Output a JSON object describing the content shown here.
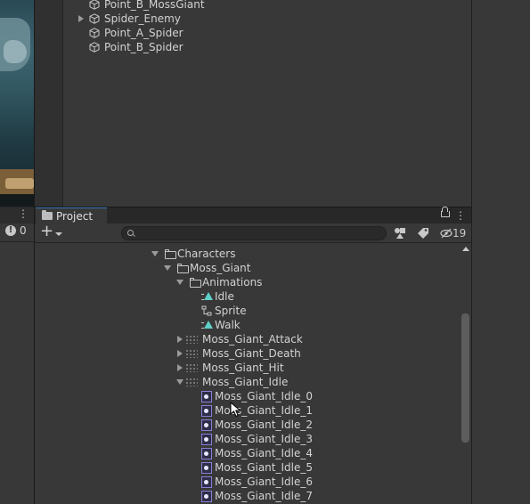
{
  "hierarchy": {
    "items": [
      {
        "label": "Point_B_MossGiant",
        "expandable": false
      },
      {
        "label": "Spider_Enemy",
        "expandable": true
      },
      {
        "label": "Point_A_Spider",
        "expandable": false
      },
      {
        "label": "Point_B_Spider",
        "expandable": false
      }
    ]
  },
  "console": {
    "info_count": "0"
  },
  "project": {
    "tab_label": "Project",
    "search_placeholder": "",
    "hidden_count": "19",
    "tree": [
      {
        "label": "Characters",
        "icon": "folder-open-icon",
        "depth": 0,
        "state": "expanded"
      },
      {
        "label": "Moss_Giant",
        "icon": "folder-open-icon",
        "depth": 1,
        "state": "expanded"
      },
      {
        "label": "Animations",
        "icon": "folder-open-icon",
        "depth": 2,
        "state": "expanded"
      },
      {
        "label": "Idle",
        "icon": "animation-clip-icon",
        "depth": 3,
        "state": "leaf"
      },
      {
        "label": "Sprite",
        "icon": "animator-controller-icon",
        "depth": 3,
        "state": "leaf"
      },
      {
        "label": "Walk",
        "icon": "animation-clip-icon",
        "depth": 3,
        "state": "leaf"
      },
      {
        "label": "Moss_Giant_Attack",
        "icon": "sprite-sheet-icon",
        "depth": 2,
        "state": "collapsed"
      },
      {
        "label": "Moss_Giant_Death",
        "icon": "sprite-sheet-icon",
        "depth": 2,
        "state": "collapsed"
      },
      {
        "label": "Moss_Giant_Hit",
        "icon": "sprite-sheet-icon",
        "depth": 2,
        "state": "collapsed"
      },
      {
        "label": "Moss_Giant_Idle",
        "icon": "sprite-sheet-icon",
        "depth": 2,
        "state": "expanded"
      },
      {
        "label": "Moss_Giant_Idle_0",
        "icon": "sprite-frame-icon",
        "depth": 3,
        "state": "leaf"
      },
      {
        "label": "Moss_Giant_Idle_1",
        "icon": "sprite-frame-icon",
        "depth": 3,
        "state": "leaf"
      },
      {
        "label": "Moss_Giant_Idle_2",
        "icon": "sprite-frame-icon",
        "depth": 3,
        "state": "leaf"
      },
      {
        "label": "Moss_Giant_Idle_3",
        "icon": "sprite-frame-icon",
        "depth": 3,
        "state": "leaf"
      },
      {
        "label": "Moss_Giant_Idle_4",
        "icon": "sprite-frame-icon",
        "depth": 3,
        "state": "leaf"
      },
      {
        "label": "Moss_Giant_Idle_5",
        "icon": "sprite-frame-icon",
        "depth": 3,
        "state": "leaf"
      },
      {
        "label": "Moss_Giant_Idle_6",
        "icon": "sprite-frame-icon",
        "depth": 3,
        "state": "leaf"
      },
      {
        "label": "Moss_Giant_Idle_7",
        "icon": "sprite-frame-icon",
        "depth": 3,
        "state": "leaf"
      }
    ]
  },
  "colors": {
    "panel_bg": "#383838",
    "dark_bg": "#282828",
    "text": "#d2d2d2",
    "tab_accent": "#3a79bb",
    "animation_clip": "#5fd0c8",
    "sprite_frame": "#8a7fd6"
  }
}
